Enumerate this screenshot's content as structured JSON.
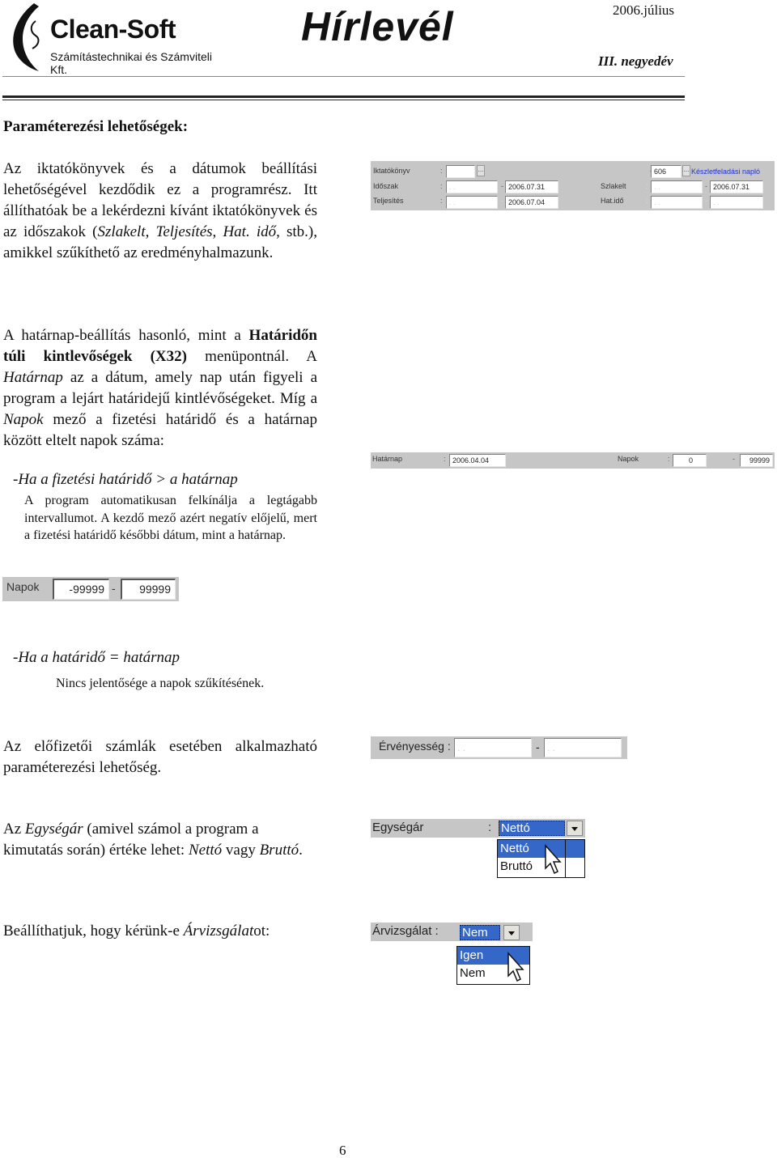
{
  "header": {
    "brand_name": "Clean-Soft",
    "brand_sub_line1": "Számítástechnikai és Számviteli",
    "brand_sub_line2": "Kft.",
    "title": "Hírlevél",
    "date": "2006.július",
    "quarter": "III. negyedév"
  },
  "content": {
    "heading": "Paraméterezési lehetőségek:",
    "p1": {
      "part1": "Az iktatókönyvek és a dátumok beállítási lehetőségével kezdődik ez a programrész. Itt állíthatóak be a lekérdezni kívánt iktatókönyvek és az időszakok (",
      "em1": "Szlakelt",
      "sep1": ", ",
      "em2": "Teljesítés",
      "sep2": ", ",
      "em3": "Hat. idő",
      "part2": ", stb.), amikkel szűkíthető az eredményhalmazunk."
    },
    "p2": {
      "part1": "A határnap-beállítás hasonló, mint a ",
      "bold1": "Határidőn túli kintlevőségek (X32)",
      "part2": " menüpontnál. A ",
      "em1": "Határnap",
      "part3": " az a dátum, amely nap után figyeli a program a lejárt határidejű kintlévőségeket. Míg a ",
      "em2": "Napok",
      "part4": " mező a fizetési határidő és a határnap között eltelt napok száma:"
    },
    "case1_title": "-Ha a fizetési határidő > a határnap",
    "case1_desc": "A program automatikusan felkínálja a legtágabb intervallumot. A kezdő mező azért negatív előjelű, mert a fizetési határidő későbbi dátum, mint a határnap.",
    "case2_title": "-Ha a határidő = határnap",
    "case2_desc": "Nincs jelentősége a napok szűkítésének.",
    "p3": "Az előfizetői számlák esetében alkalmazható paraméterezési lehetőség.",
    "p4": {
      "part1": "Az ",
      "em1": "Egységár",
      "part2": " (amivel számol a program a kimutatás során) értéke lehet: ",
      "em2": "Nettó",
      "part3": " vagy ",
      "em3": "Bruttó",
      "part4": "."
    },
    "p5": {
      "part1": "Beállíthatjuk, hogy kérünk-e ",
      "em1": "Árvizsgálat",
      "part2": "ot:"
    },
    "page_number": "6"
  },
  "screens": {
    "dates_panel": {
      "iktatokonyv_label": "Iktatókönyv",
      "iktatokonyv_from": "",
      "iktatokonyv_to": "606",
      "iktatokonyv_name": "Készletfeladási napló",
      "idoszak_label": "Időszak",
      "idoszak_from": ". .",
      "idoszak_to": "2006.07.31",
      "teljesites_label": "Teljesítés",
      "teljesites_from": ". .",
      "teljesites_to": "2006.07.04",
      "szlakelt_label": "Szlakelt",
      "szlakelt_from": ". .",
      "szlakelt_to": "2006.07.31",
      "hatido_label": "Hat.idő",
      "hatido_from": ". .",
      "hatido_to": ". .",
      "colon": ":",
      "dash": "-",
      "dots_button": "..."
    },
    "hatarnap_panel": {
      "hatarnap_label": "Határnap",
      "hatarnap_value": "2006.04.04",
      "napok_label": "Napok",
      "napok_from": "0",
      "napok_to": "99999",
      "colon": ":",
      "dash": "-"
    },
    "napok_panel": {
      "label": "Napok",
      "from": "-99999",
      "to": "99999",
      "dash": "-"
    },
    "ervenyesseg_panel": {
      "label": "Érvényesség :",
      "from": ". .",
      "to": ". .",
      "dash": "-"
    },
    "egysegar_panel": {
      "label": "Egységár",
      "colon": ":",
      "selected": "Nettó",
      "options": [
        "Nettó",
        "Bruttó"
      ],
      "highlighted_index": 0
    },
    "arvizsgalat_panel": {
      "label": "Árvizsgálat :",
      "selected": "Nem",
      "options": [
        "Igen",
        "Nem"
      ],
      "highlighted_index": 0
    }
  },
  "colors": {
    "panel_gray": "#c6c6c6",
    "selection_blue": "#3567c8",
    "link_blue": "#2233cc"
  }
}
